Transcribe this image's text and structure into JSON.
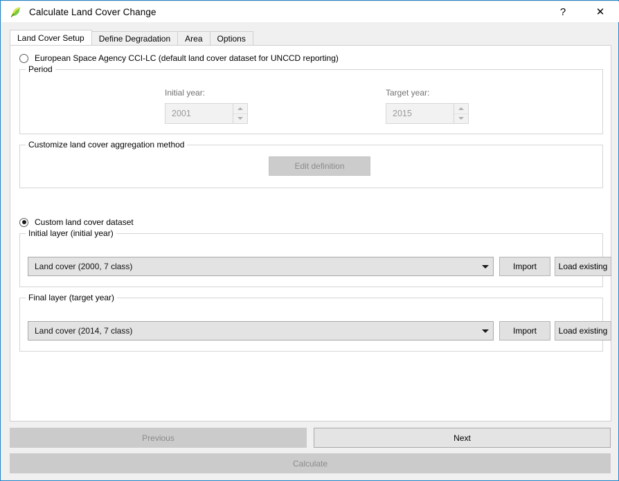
{
  "window": {
    "title": "Calculate Land Cover Change",
    "icon": "leaf-icon",
    "help_label": "?",
    "close_label": "✕"
  },
  "tabs": [
    {
      "label": "Land Cover Setup",
      "selected": true
    },
    {
      "label": "Define Degradation",
      "selected": false
    },
    {
      "label": "Area",
      "selected": false
    },
    {
      "label": "Options",
      "selected": false
    }
  ],
  "esa_option": {
    "label": "European Space Agency CCI-LC (default land cover dataset for UNCCD reporting)",
    "checked": false
  },
  "period_group": {
    "title": "Period",
    "initial_year_label": "Initial year:",
    "initial_year_value": "2001",
    "target_year_label": "Target year:",
    "target_year_value": "2015"
  },
  "aggregation_group": {
    "title": "Customize land cover aggregation method",
    "edit_button_label": "Edit definition"
  },
  "custom_option": {
    "label": "Custom land cover dataset",
    "checked": true
  },
  "initial_layer_group": {
    "title": "Initial layer (initial year)",
    "combo_value": "Land cover (2000, 7 class)",
    "import_label": "Import",
    "load_existing_label": "Load existing"
  },
  "final_layer_group": {
    "title": "Final layer (target year)",
    "combo_value": "Land cover (2014, 7 class)",
    "import_label": "Import",
    "load_existing_label": "Load existing"
  },
  "footer": {
    "previous_label": "Previous",
    "next_label": "Next",
    "calculate_label": "Calculate"
  },
  "colors": {
    "window_border": "#1e82c8",
    "panel_bg": "#ffffff",
    "dialog_bg": "#f0f0f0",
    "combo_bg": "#e3e3e3",
    "disabled_btn": "#cccccc"
  }
}
